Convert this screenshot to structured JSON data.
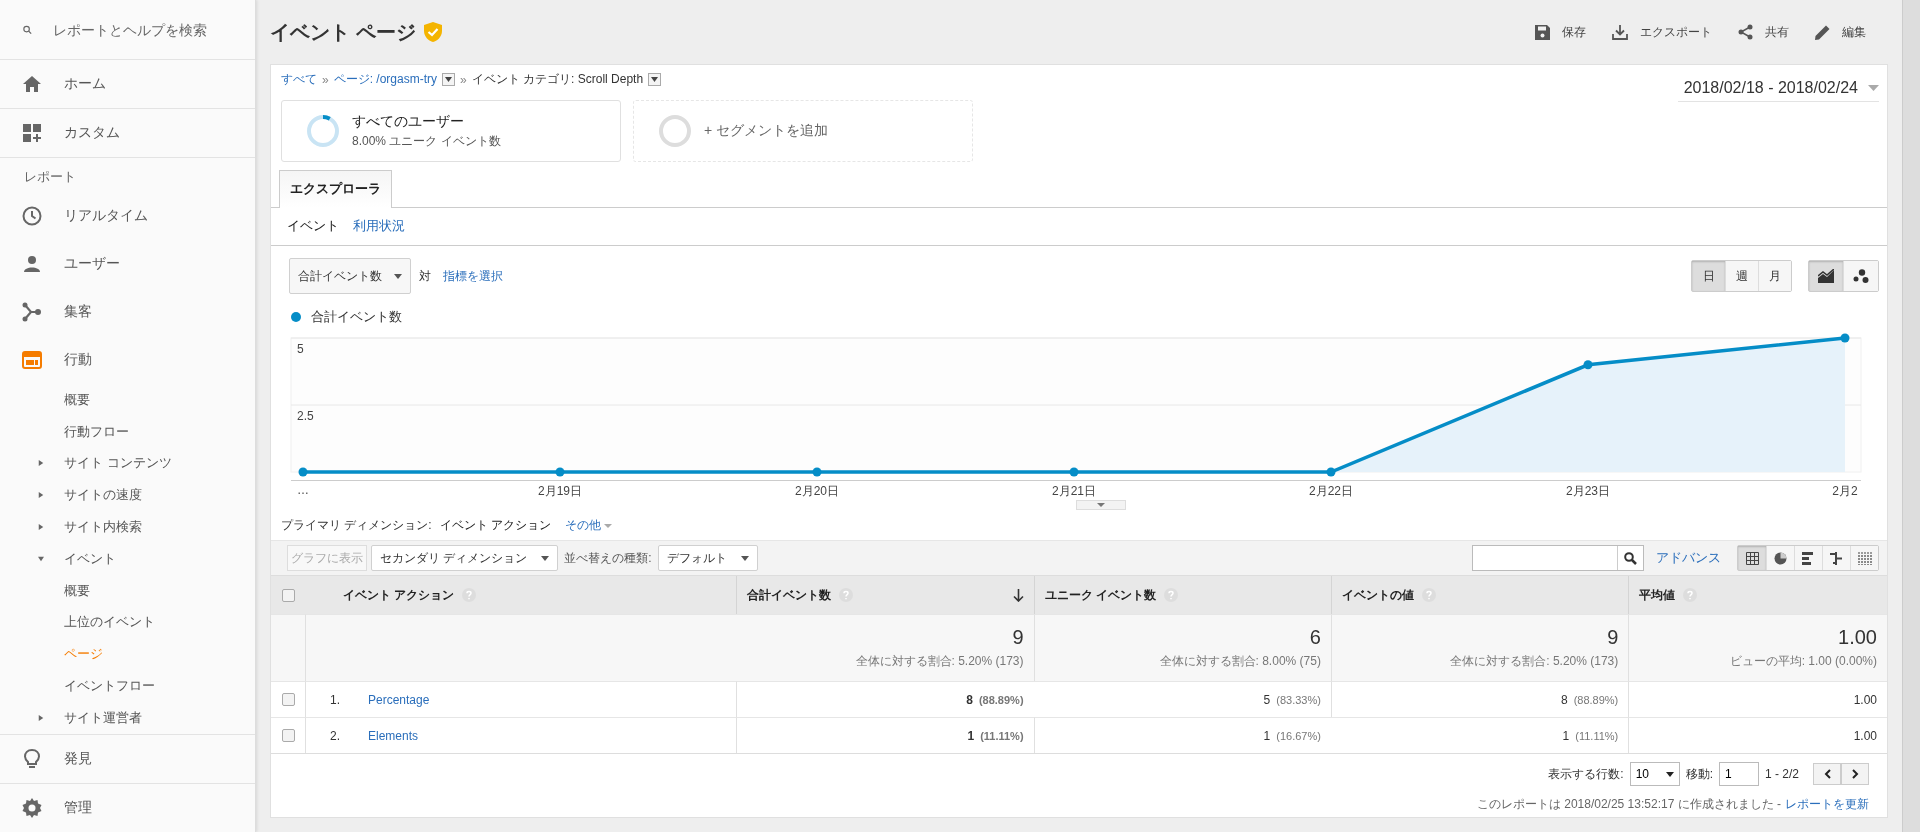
{
  "sidebar": {
    "search": {
      "placeholder": "レポートとヘルプを検索"
    },
    "top_items": [
      {
        "label": "ホーム"
      },
      {
        "label": "カスタム"
      }
    ],
    "section_label": "レポート",
    "items": [
      {
        "label": "リアルタイム",
        "expanded": false
      },
      {
        "label": "ユーザー",
        "expanded": false
      },
      {
        "label": "集客",
        "expanded": false
      },
      {
        "label": "行動",
        "expanded": true,
        "children": [
          {
            "label": "概要",
            "kind": "link",
            "selected": false
          },
          {
            "label": "行動フロー",
            "kind": "link",
            "selected": false
          },
          {
            "label": "サイト コンテンツ",
            "kind": "group",
            "expanded": false,
            "selected": false
          },
          {
            "label": "サイトの速度",
            "kind": "group",
            "expanded": false,
            "selected": false
          },
          {
            "label": "サイト内検索",
            "kind": "group",
            "expanded": false,
            "selected": false
          },
          {
            "label": "イベント",
            "kind": "group",
            "expanded": true,
            "selected": false,
            "children": [
              {
                "label": "概要",
                "selected": false
              },
              {
                "label": "上位のイベント",
                "selected": false
              },
              {
                "label": "ページ",
                "selected": true
              },
              {
                "label": "イベントフロー",
                "selected": false
              }
            ]
          },
          {
            "label": "サイト運営者",
            "kind": "group",
            "expanded": false,
            "selected": false
          }
        ]
      }
    ],
    "bottom_items": [
      {
        "label": "発見"
      },
      {
        "label": "管理"
      }
    ]
  },
  "header": {
    "title": "イベント ページ",
    "verified": true,
    "actions": [
      {
        "label": "保存",
        "kind": "save"
      },
      {
        "label": "エクスポート",
        "kind": "export"
      },
      {
        "label": "共有",
        "kind": "share"
      },
      {
        "label": "編集",
        "kind": "edit"
      }
    ]
  },
  "breadcrumb": {
    "separator": "»",
    "items": [
      {
        "label": "すべて",
        "kind": "link"
      },
      {
        "label": "ページ: /orgasm-try",
        "kind": "link-dropdown"
      },
      {
        "label": "イベント カテゴリ: Scroll Depth",
        "kind": "text-dropdown"
      }
    ]
  },
  "date_range": "2018/02/18 - 2018/02/24",
  "segments": [
    {
      "kind": "segment",
      "title": "すべてのユーザー",
      "subtitle": "8.00% ユニーク イベント数",
      "level": 0.08
    },
    {
      "kind": "add",
      "title": "+ セグメントを追加"
    }
  ],
  "tabs": [
    {
      "label": "エクスプローラ",
      "selected": true
    }
  ],
  "subtabs": [
    {
      "label": "イベント",
      "selected": true
    },
    {
      "label": "利用状況",
      "selected": false
    }
  ],
  "chart_controls": {
    "metric": "合計イベント数",
    "versus": "対",
    "select_metric": "指標を選択",
    "periods": [
      {
        "label": "日",
        "selected": true
      },
      {
        "label": "週",
        "selected": false
      },
      {
        "label": "月",
        "selected": false
      }
    ],
    "chart_types": [
      {
        "kind": "line",
        "selected": true
      },
      {
        "kind": "motion",
        "selected": false
      }
    ]
  },
  "chart": {
    "chart_data": {
      "type": "area",
      "categories": [
        "…",
        "2月19日",
        "2月20日",
        "2月21日",
        "2月22日",
        "2月23日",
        "2月2"
      ],
      "series": [
        {
          "name": "合計イベント数",
          "color": "#058dc7",
          "values": [
            0,
            0,
            0,
            0,
            0,
            4,
            5
          ]
        }
      ],
      "ylim": [
        0,
        5
      ],
      "yticks": [
        2.5,
        5
      ]
    }
  },
  "primary_dimension": {
    "label": "プライマリ ディメンション:",
    "value": "イベント アクション",
    "other": "その他"
  },
  "toolbar": {
    "plot_rows": {
      "label": "グラフに表示",
      "disabled": true
    },
    "secondary": "セカンダリ ディメンション",
    "sort_label": "並べ替えの種類:",
    "sort_value": "デフォルト",
    "advanced": "アドバンス",
    "views": [
      {
        "kind": "table",
        "selected": true
      },
      {
        "kind": "pie",
        "selected": false
      },
      {
        "kind": "bars",
        "selected": false
      },
      {
        "kind": "comparison",
        "selected": false
      },
      {
        "kind": "pivot",
        "selected": false
      }
    ]
  },
  "table": {
    "select_all_checked": false,
    "columns": [
      {
        "label": "イベント アクション",
        "sorted": false
      },
      {
        "label": "合計イベント数",
        "sorted": true
      },
      {
        "label": "ユニーク イベント数",
        "sorted": false
      },
      {
        "label": "イベントの値",
        "sorted": false
      },
      {
        "label": "平均値",
        "sorted": false
      }
    ],
    "totals": [
      {
        "value": "9",
        "note": "全体に対する割合: 5.20% (173)"
      },
      {
        "value": "6",
        "note": "全体に対する割合: 8.00% (75)"
      },
      {
        "value": "9",
        "note": "全体に対する割合: 5.20% (173)"
      },
      {
        "value": "1.00",
        "note": "ビューの平均: 1.00 (0.00%)"
      }
    ],
    "rows": [
      {
        "index": "1.",
        "label": "Percentage",
        "checked": false,
        "cells": [
          {
            "value": "8",
            "pct": "(88.89%)"
          },
          {
            "value": "5",
            "pct": "(83.33%)"
          },
          {
            "value": "8",
            "pct": "(88.89%)"
          },
          {
            "value": "1.00"
          }
        ]
      },
      {
        "index": "2.",
        "label": "Elements",
        "checked": false,
        "cells": [
          {
            "value": "1",
            "pct": "(11.11%)"
          },
          {
            "value": "1",
            "pct": "(16.67%)"
          },
          {
            "value": "1",
            "pct": "(11.11%)"
          },
          {
            "value": "1.00"
          }
        ]
      }
    ]
  },
  "footer": {
    "rows_label": "表示する行数:",
    "rows_value": "10",
    "goto_label": "移動:",
    "goto_value": "1",
    "range": "1 - 2/2",
    "note": "このレポートは 2018/02/25 13:52:17 に作成されました -",
    "refresh": "レポートを更新"
  }
}
